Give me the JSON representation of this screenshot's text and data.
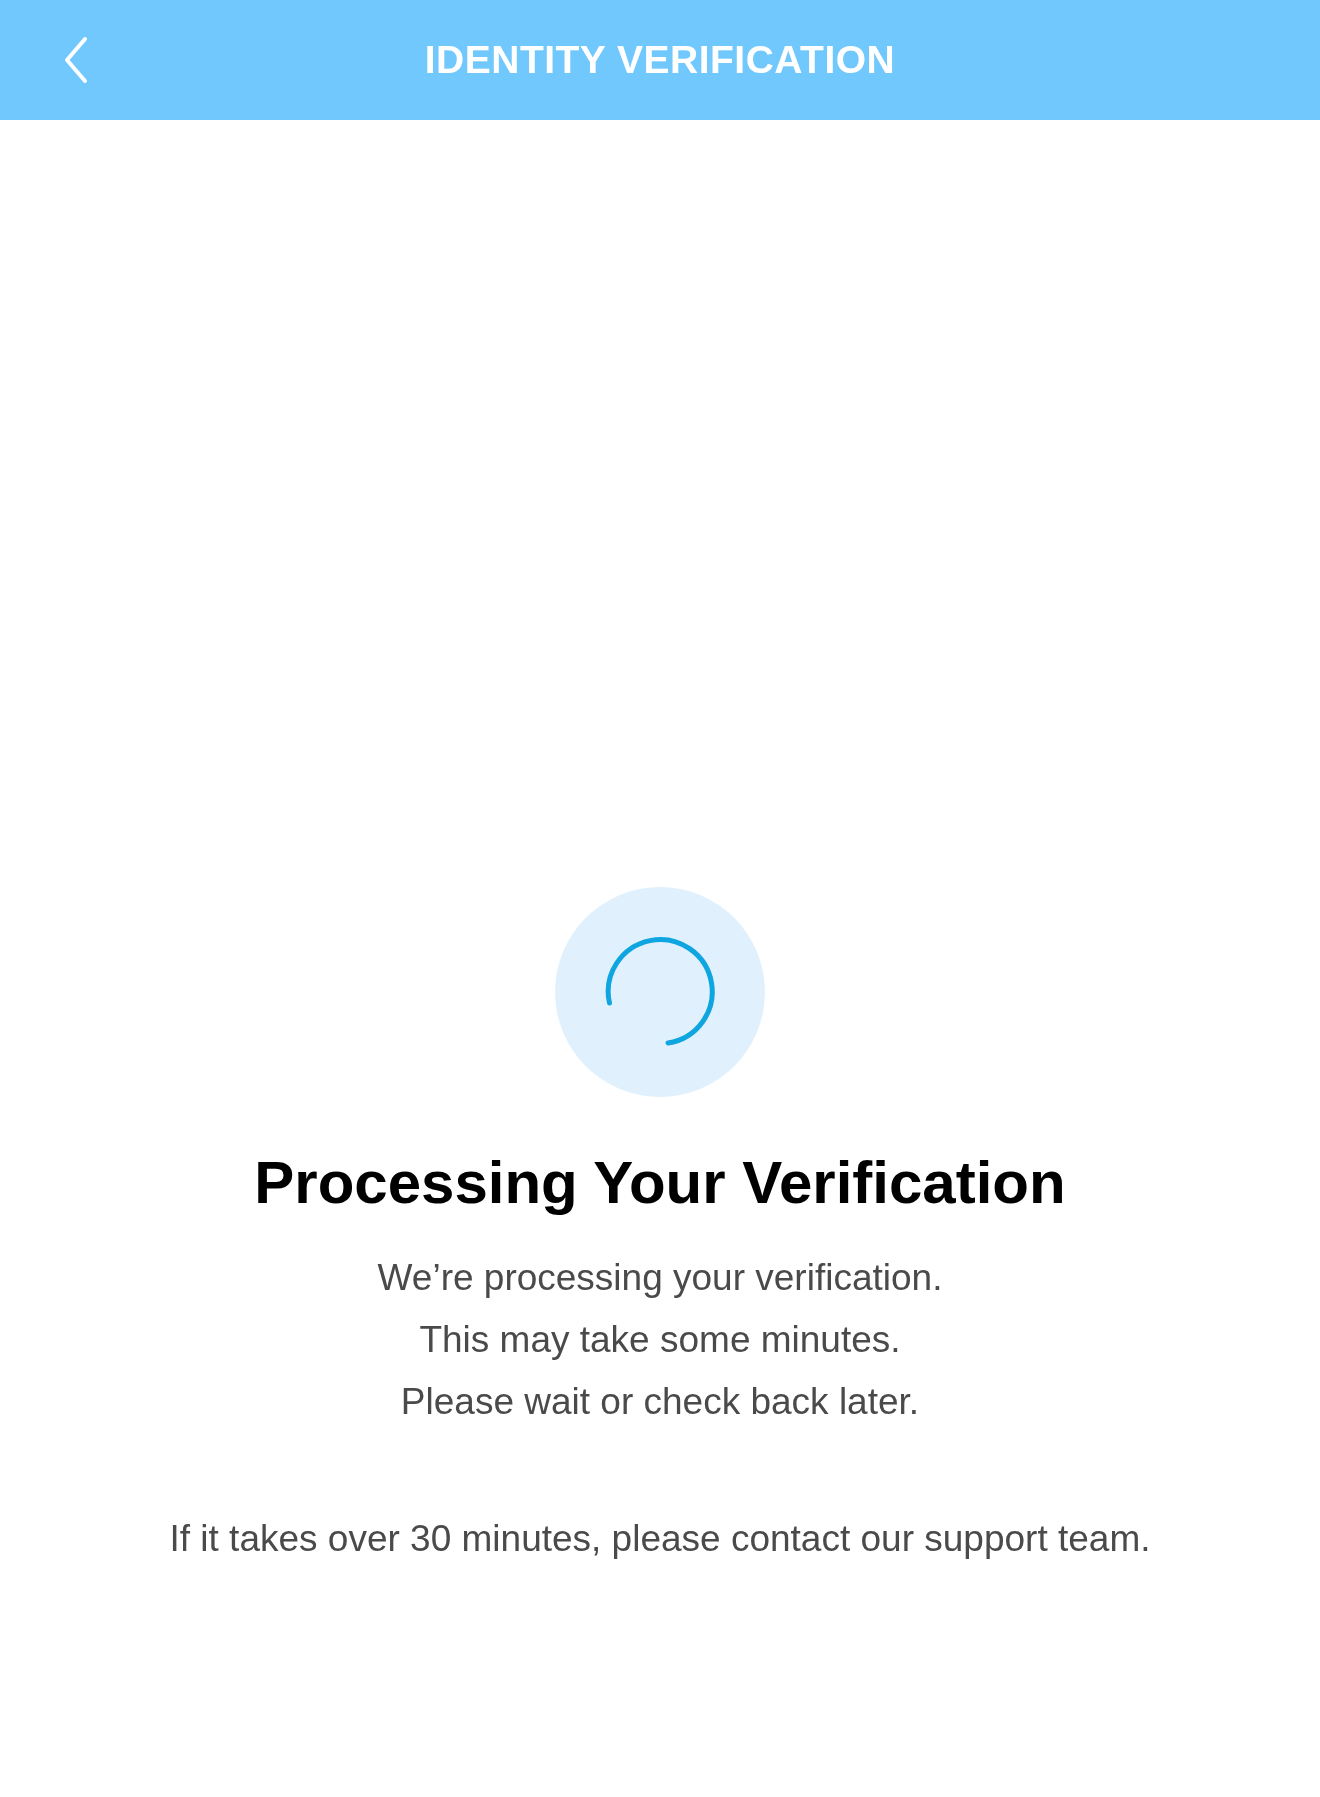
{
  "header": {
    "title": "IDENTITY VERIFICATION"
  },
  "status": {
    "title": "Processing Your Verification",
    "lines": [
      "We’re processing your verification.",
      "This may take some minutes.",
      "Please wait or check back later."
    ],
    "note": "If it takes over 30 minutes, please contact our support team."
  }
}
